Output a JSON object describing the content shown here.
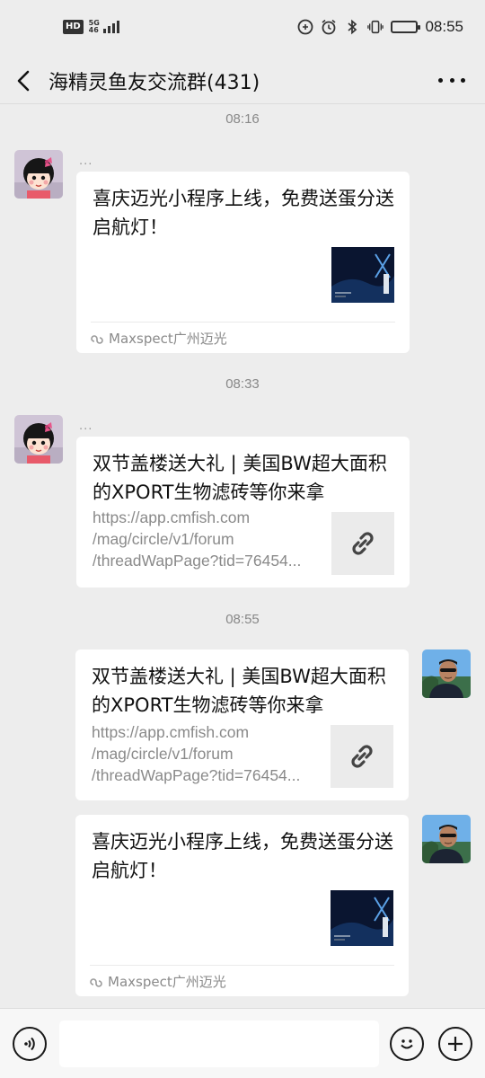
{
  "status_bar": {
    "hd": "HD",
    "network_top": "5G",
    "network_bottom": "46",
    "time": "08:55"
  },
  "header": {
    "title": "海精灵鱼友交流群(431)",
    "back_icon": "chevron-left-icon",
    "more_icon": "more-dots-icon"
  },
  "messages": [
    {
      "type": "time",
      "text": "08:16"
    },
    {
      "type": "mini-program-card",
      "side": "left",
      "sender_name": "...",
      "title": "喜庆迈光小程序上线，免费送蛋分送启航灯！",
      "source": "Maxspect广州迈光"
    },
    {
      "type": "time",
      "text": "08:33"
    },
    {
      "type": "link-card",
      "side": "left",
      "sender_name": "...",
      "title": "双节盖楼送大礼 | 美国BW超大面积的XPORT生物滤砖等你来拿",
      "url_lines": [
        "https://app.cmfish.com",
        "/mag/circle/v1/forum",
        "/threadWapPage?tid=76454..."
      ]
    },
    {
      "type": "time",
      "text": "08:55"
    },
    {
      "type": "link-card",
      "side": "right",
      "title": "双节盖楼送大礼 | 美国BW超大面积的XPORT生物滤砖等你来拿",
      "url_lines": [
        "https://app.cmfish.com",
        "/mag/circle/v1/forum",
        "/threadWapPage?tid=76454..."
      ]
    },
    {
      "type": "mini-program-card",
      "side": "right",
      "title": "喜庆迈光小程序上线，免费送蛋分送启航灯！",
      "source": "Maxspect广州迈光"
    }
  ],
  "input_bar": {
    "voice_icon": "voice-icon",
    "emoji_icon": "emoji-icon",
    "plus_icon": "plus-icon",
    "input_value": ""
  },
  "colors": {
    "background": "#ededed",
    "card": "#ffffff",
    "muted_text": "#8a8a8a",
    "time_text": "#888888"
  }
}
